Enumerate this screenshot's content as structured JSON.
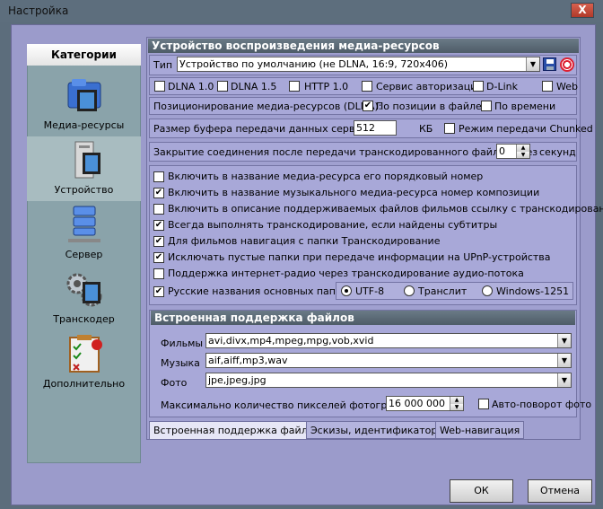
{
  "window": {
    "title": "Настройка",
    "close_glyph": "X"
  },
  "categories": {
    "header": "Категории",
    "items": [
      {
        "label": "Медиа-ресурсы"
      },
      {
        "label": "Устройство"
      },
      {
        "label": "Сервер"
      },
      {
        "label": "Транскодер"
      },
      {
        "label": "Дополнительно"
      }
    ]
  },
  "device": {
    "section_title": "Устройство воспроизведения медиа-ресурсов",
    "type_label": "Тип",
    "type_value": "Устройство по умолчанию (не DLNA, 16:9, 720x406)",
    "flags": [
      {
        "label": "DLNA 1.0",
        "checked": false
      },
      {
        "label": "DLNA 1.5",
        "checked": false
      },
      {
        "label": "HTTP 1.0",
        "checked": false
      },
      {
        "label": "Сервис авторизации",
        "checked": false
      },
      {
        "label": "D-Link",
        "checked": false
      },
      {
        "label": "Web",
        "checked": false
      }
    ],
    "positioning_label": "Позиционирование медиа-ресурсов (DLNA):",
    "pos_by_file": {
      "label": "По позиции в файле",
      "checked": true
    },
    "pos_by_time": {
      "label": "По времени",
      "checked": false
    },
    "buffer_label": "Размер буфера передачи данных сервера",
    "buffer_value": "512",
    "buffer_unit": "КБ",
    "chunked": {
      "label": "Режим передачи Chunked",
      "checked": false
    },
    "close_label": "Закрытие соединения после передачи транскодированного файла через",
    "close_value": "0",
    "close_unit": "секунд"
  },
  "options": [
    {
      "label": "Включить в название медиа-ресурса его порядковый номер",
      "checked": false
    },
    {
      "label": "Включить в название музыкального медиа-ресурса номер композиции",
      "checked": true
    },
    {
      "label": "Включить в описание поддерживаемых файлов фильмов ссылку с транскодированием",
      "checked": false
    },
    {
      "label": "Всегда выполнять транскодирование, если найдены субтитры",
      "checked": true
    },
    {
      "label": "Для фильмов навигация с папки Транскодирование",
      "checked": true
    },
    {
      "label": "Исключать пустые папки при передаче информации на  UPnP-устройства",
      "checked": true
    },
    {
      "label": "Поддержка интернет-радио через транскодирование аудио-потока",
      "checked": false
    },
    {
      "label": "Русские названия основных папок",
      "checked": true
    }
  ],
  "encoding": {
    "options": [
      {
        "label": "UTF-8",
        "selected": true
      },
      {
        "label": "Транслит",
        "selected": false
      },
      {
        "label": "Windows-1251",
        "selected": false
      }
    ]
  },
  "builtin": {
    "section_title": "Встроенная поддержка файлов",
    "films_label": "Фильмы",
    "films_value": "avi,divx,mp4,mpeg,mpg,vob,xvid",
    "music_label": "Музыка",
    "music_value": "aif,aiff,mp3,wav",
    "photo_label": "Фото",
    "photo_value": "jpe,jpeg,jpg",
    "maxpix_label": "Максимально количество пикселей фотографий",
    "maxpix_value": "16 000 000",
    "autorotate": {
      "label": "Авто-поворот фото",
      "checked": false
    }
  },
  "tabs": [
    {
      "label": "Встроенная поддержка файлов",
      "active": true
    },
    {
      "label": "Эскизы, идентификаторы",
      "active": false
    },
    {
      "label": "Web-навигация",
      "active": false
    }
  ],
  "buttons": {
    "ok": "ОК",
    "cancel": "Отмена"
  },
  "colors": {
    "accent_header": "#4e5c68",
    "panel": "#a0a0d0",
    "category_panel": "#8aa3aa"
  }
}
